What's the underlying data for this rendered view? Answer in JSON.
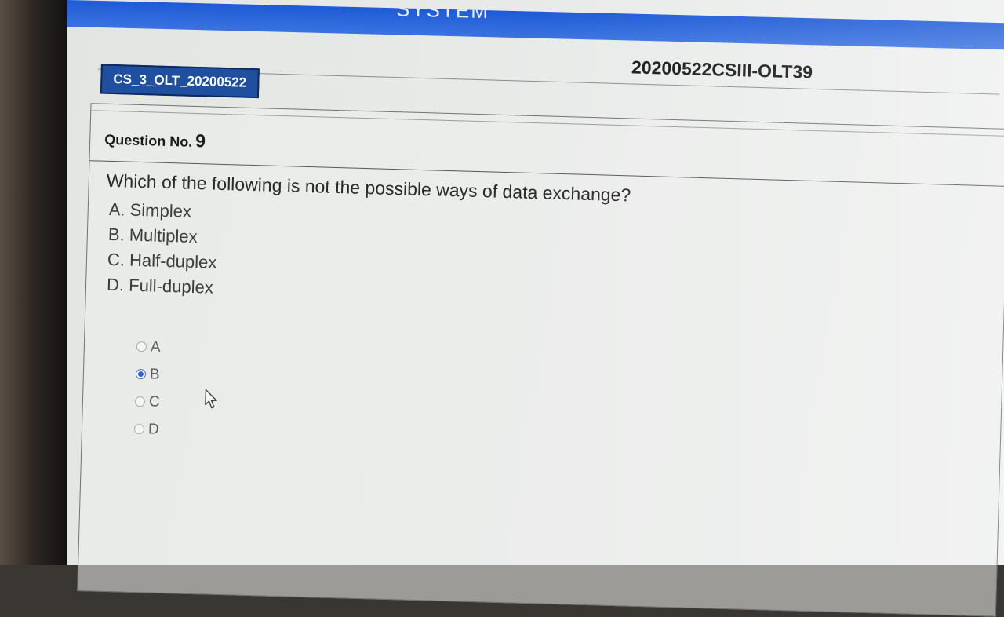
{
  "header": {
    "banner_title": "SYSTEM",
    "test_code": "20200522CSIII-OLT39"
  },
  "section_tab": {
    "label": "CS_3_OLT_20200522"
  },
  "question": {
    "number_label": "Question No.",
    "number": "9",
    "text": "Which of the following is not the possible ways of data exchange?",
    "options": [
      "A. Simplex",
      "B. Multiplex",
      "C. Half-duplex",
      "D. Full-duplex"
    ]
  },
  "answers": {
    "choices": [
      "A",
      "B",
      "C",
      "D"
    ],
    "selected": "B"
  },
  "colors": {
    "banner": "#1e5ad6",
    "tab": "#1f4f9e",
    "radio_selected": "#2c63c9"
  },
  "icons": {
    "cursor": "mouse-pointer-icon"
  }
}
